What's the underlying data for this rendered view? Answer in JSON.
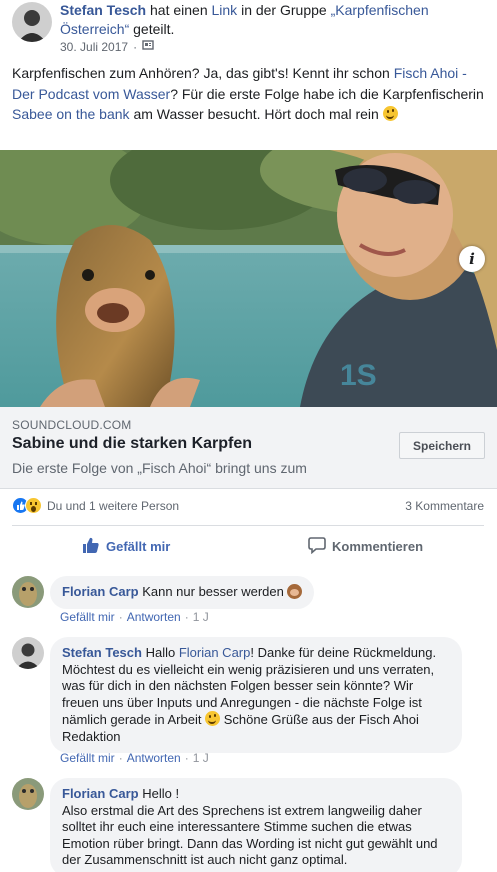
{
  "post": {
    "author": "Stefan Tesch",
    "shared_a": "hat einen",
    "link_word": "Link",
    "shared_b": "in der Gruppe",
    "group": "„Karpfenfischen Österreich“",
    "shared_c": "geteilt.",
    "date": "30. Juli 2017",
    "privacy_icon": "group-privacy-icon",
    "text_1": "Karpfenfischen zum Anhören? Ja, das gibt's! Kennt ihr schon",
    "text_link_1": "Fisch Ahoi - Der Podcast vom Wasser",
    "text_2": "? Für die erste Folge habe ich die Karpfenfischerin",
    "text_link_2": "Sabee on the bank",
    "text_3": "am Wasser besucht. Hört doch mal rein"
  },
  "link_card": {
    "domain": "SOUNDCLOUD.COM",
    "title": "Sabine und die starken Karpfen",
    "description": "Die erste Folge von „Fisch Ahoi“ bringt uns zum",
    "save_label": "Speichern",
    "info_label": "i"
  },
  "reactions": {
    "who": "Du und 1 weitere Person",
    "comments_count": "3 Kommentare"
  },
  "actions": {
    "like": "Gefällt mir",
    "comment": "Kommentieren"
  },
  "comments": [
    {
      "author": "Florian Carp",
      "text": "Kann nur besser werden",
      "like": "Gefällt mir",
      "reply": "Antworten",
      "age": "1 J"
    },
    {
      "author": "Stefan Tesch",
      "text_a": "Hallo",
      "mention": "Florian Carp",
      "text_b": "! Danke für deine Rückmeldung. Möchtest du es vielleicht ein wenig präzisieren und uns verraten, was für dich in den nächsten Folgen besser sein könnte? Wir freuen uns über Inputs und Anregungen - die nächste Folge ist nämlich gerade in Arbeit",
      "text_c": "Schöne Grüße aus der Fisch Ahoi Redaktion",
      "like": "Gefällt mir",
      "reply": "Antworten",
      "age": "1 J"
    },
    {
      "author": "Florian Carp",
      "text_a": "Hello !",
      "text_b": "Also erstmal die Art des Sprechens ist extrem langweilig daher solltet ihr euch eine interessantere Stimme suchen die etwas Emotion rüber bringt. Dann das Wording ist nicht gut gewählt und der Zusammenschnitt ist auch nicht ganz optimal."
    }
  ],
  "colors": {
    "link": "#385898",
    "action_blue": "#4267b2",
    "bubble": "#f2f3f5",
    "card": "#f2f3f5"
  }
}
